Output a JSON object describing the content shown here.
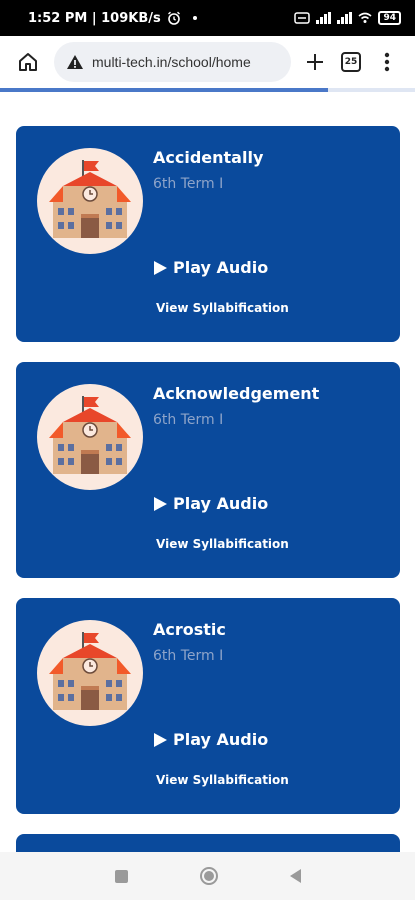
{
  "status": {
    "time_speed": "1:52 PM | 109KB/s",
    "battery": "94"
  },
  "browser": {
    "url": "multi-tech.in/school/home",
    "tab_count": "25",
    "progress": 0.79
  },
  "cards": [
    {
      "word": "Accidentally",
      "term": "6th Term I",
      "play": "Play Audio",
      "syllabification": "View Syllabification"
    },
    {
      "word": "Acknowledgement",
      "term": "6th Term I",
      "play": "Play Audio",
      "syllabification": "View Syllabification"
    },
    {
      "word": "Acrostic",
      "term": "6th Term I",
      "play": "Play Audio",
      "syllabification": "View Syllabification"
    }
  ],
  "icons": {
    "card_avatar": "school-building-icon",
    "home": "home-icon",
    "site_info": "warning-icon",
    "new_tab": "plus-icon",
    "menu": "more-vert-icon"
  },
  "colors": {
    "card_bg": "#0a4a9c",
    "term_text": "#8ea4c9",
    "progress": "#4a78c8"
  }
}
